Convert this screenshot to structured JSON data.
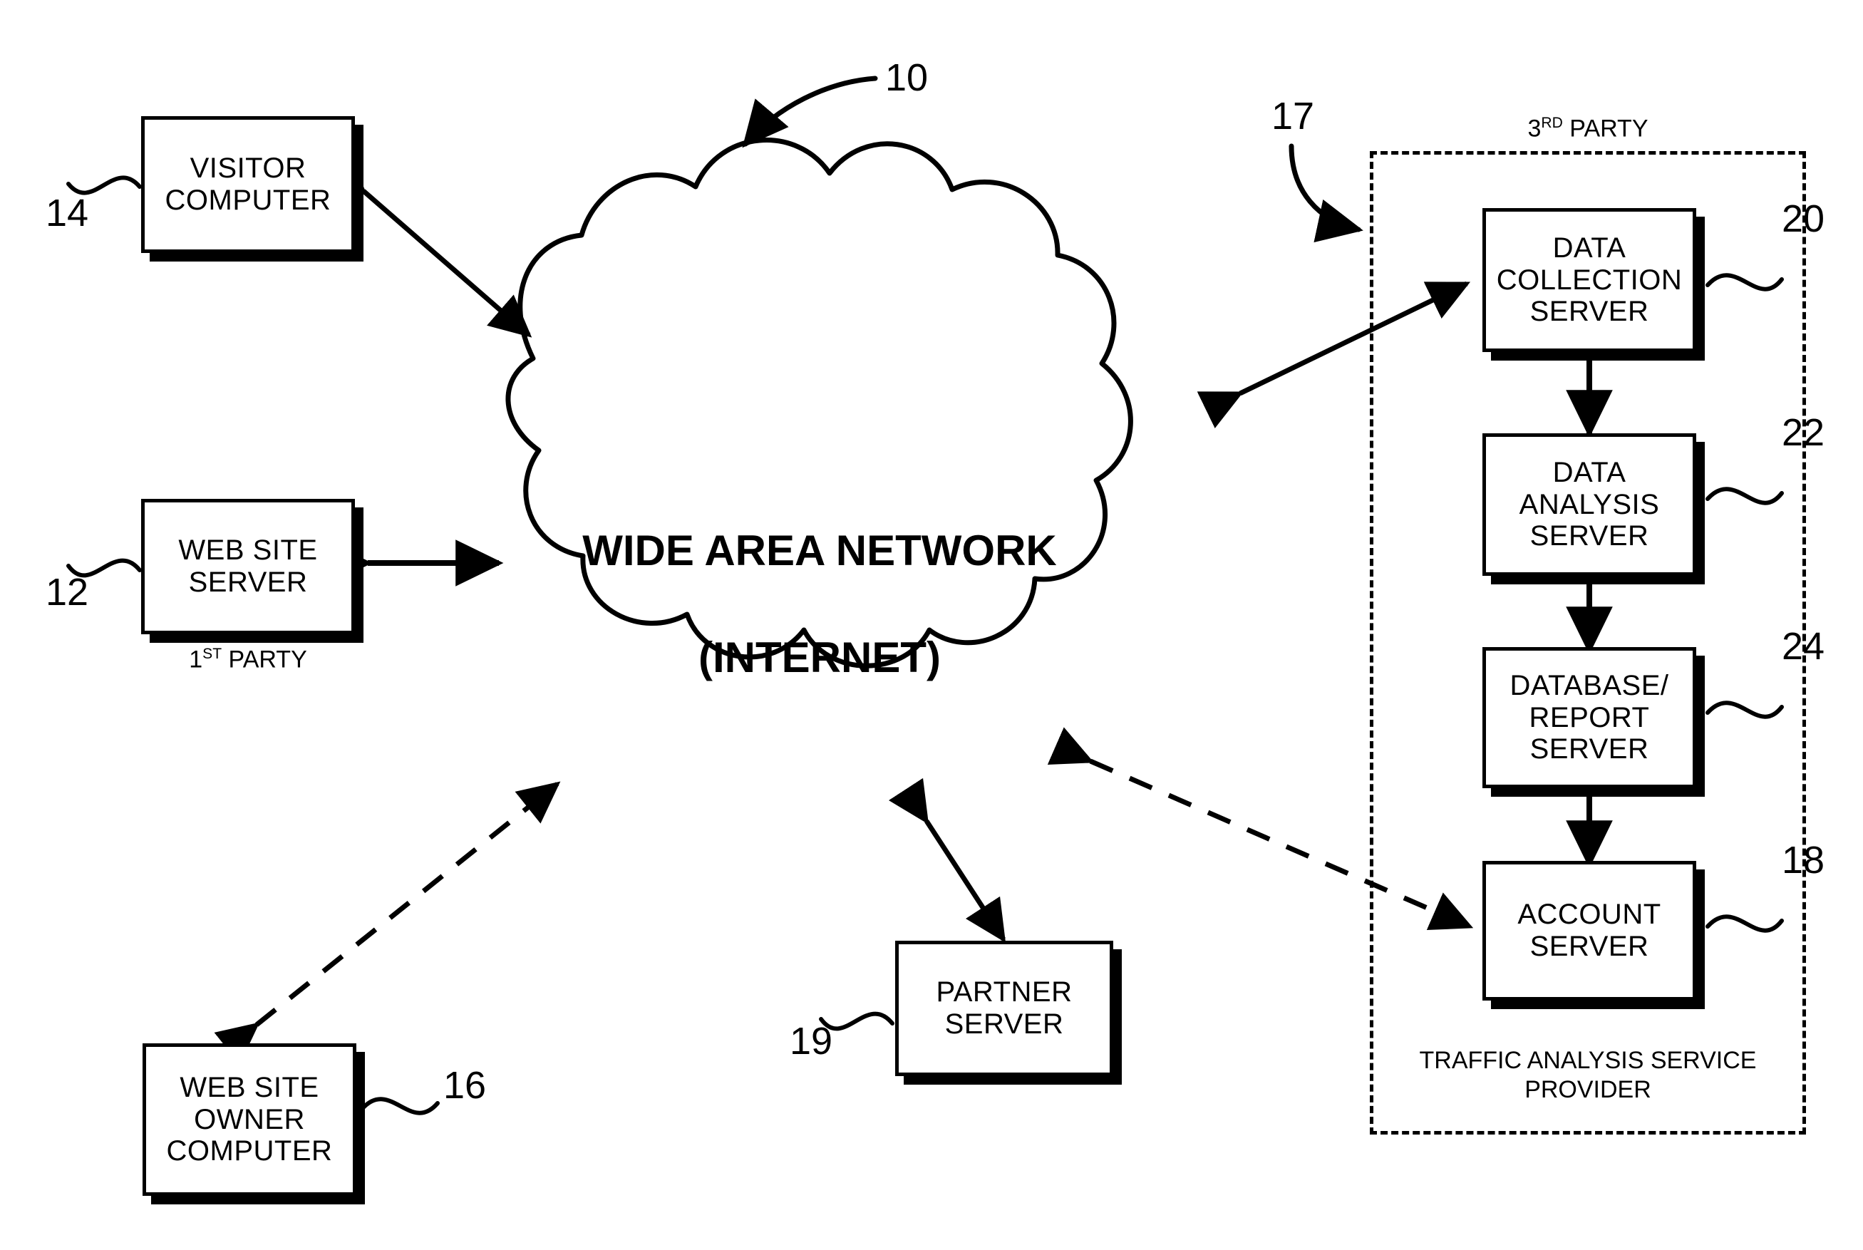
{
  "figure": {
    "reference_numeral": "10",
    "cloud": {
      "line1": "WIDE AREA NETWORK",
      "line2": "(INTERNET)"
    },
    "nodes": [
      {
        "id": "visitor-computer",
        "label": "VISITOR\nCOMPUTER",
        "ref": "14"
      },
      {
        "id": "web-site-server",
        "label": "WEB SITE\nSERVER",
        "ref": "12"
      },
      {
        "id": "web-site-owner",
        "label": "WEB SITE\nOWNER\nCOMPUTER",
        "ref": "16"
      },
      {
        "id": "partner-server",
        "label": "PARTNER\nSERVER",
        "ref": "19"
      },
      {
        "id": "data-collection",
        "label": "DATA\nCOLLECTION\nSERVER",
        "ref": "20"
      },
      {
        "id": "data-analysis",
        "label": "DATA\nANALYSIS\nSERVER",
        "ref": "22"
      },
      {
        "id": "database-report",
        "label": "DATABASE/\nREPORT\nSERVER",
        "ref": "24"
      },
      {
        "id": "account-server",
        "label": "ACCOUNT\nSERVER",
        "ref": "18"
      }
    ],
    "captions": {
      "first_party": "1ST PARTY",
      "first_party_prefix": "1",
      "first_party_sup": "ST",
      "first_party_suffix": " PARTY",
      "third_party_prefix": "3",
      "third_party_sup": "RD",
      "third_party_suffix": " PARTY",
      "provider": "TRAFFIC ANALYSIS SERVICE\nPROVIDER"
    },
    "third_party_group_ref": "17",
    "colors": {
      "ink": "#000000",
      "paper": "#ffffff"
    }
  }
}
